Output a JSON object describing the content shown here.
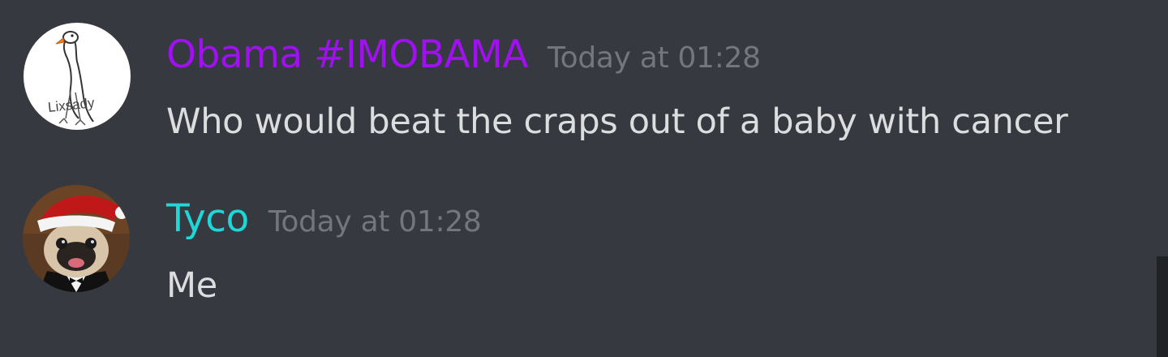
{
  "messages": [
    {
      "username": "Obama #IMOBAMA",
      "username_color": "#a010f0",
      "timestamp": "Today at 01:28",
      "text": "Who would beat the craps out of a baby with cancer",
      "avatar": {
        "icon": "goose-drawing-avatar",
        "caption": "Lixsady"
      }
    },
    {
      "username": "Tyco",
      "username_color": "#1fd6d8",
      "timestamp": "Today at 01:28",
      "text": "Me",
      "avatar": {
        "icon": "pug-santa-hat-avatar"
      }
    }
  ],
  "theme": {
    "background": "#36393f",
    "text": "#dcddde",
    "timestamp": "#72767d",
    "scrollbar": "#202225"
  }
}
